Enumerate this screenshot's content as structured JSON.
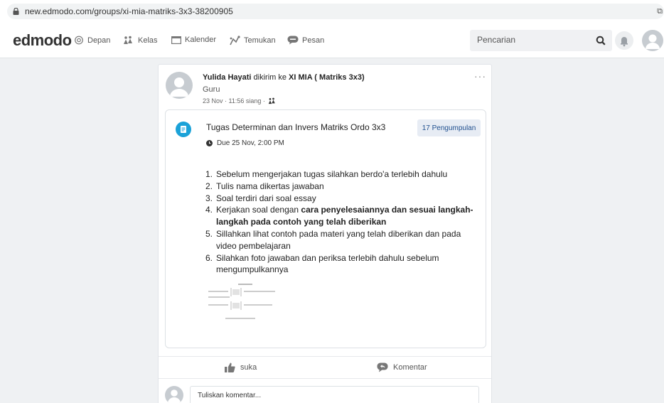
{
  "browser": {
    "url": "new.edmodo.com/groups/xi-mia-matriks-3x3-38200905",
    "ext_glyph": "⧉"
  },
  "nav": {
    "logo": "edmodo",
    "items": [
      {
        "label": "Depan",
        "icon": "home-icon"
      },
      {
        "label": "Kelas",
        "icon": "class-icon"
      },
      {
        "label": "Kalender",
        "icon": "calendar-icon"
      },
      {
        "label": "Temukan",
        "icon": "discover-icon"
      },
      {
        "label": "Pesan",
        "icon": "message-icon"
      }
    ],
    "search_placeholder": "Pencarian"
  },
  "post": {
    "author": "Yulida Hayati",
    "sent_to_text": " dikirim ke ",
    "group": "XI MIA ( Matriks 3x3)",
    "role": "Guru",
    "timestamp": "23 Nov · 11:56 siang ·",
    "more": "···",
    "assignment": {
      "title": "Tugas Determinan dan Invers Matriks Ordo 3x3",
      "due": "Due 25 Nov, 2:00 PM",
      "submissions": "17 Pengumpulan",
      "instructions": [
        {
          "num": "1.",
          "text": "Sebelum mengerjakan tugas silahkan berdo'a terlebih dahulu"
        },
        {
          "num": "2.",
          "text": "Tulis nama dikertas jawaban"
        },
        {
          "num": "3.",
          "text": "Soal terdiri dari soal essay"
        },
        {
          "num": "4.",
          "pre": "Kerjakan soal dengan ",
          "bold": "cara penyelesaiannya dan sesuai langkah-langkah pada contoh yang telah diberikan"
        },
        {
          "num": "5.",
          "text": "Sillahkan lihat contoh pada materi yang telah diberikan dan pada video pembelajaran"
        },
        {
          "num": "6.",
          "text": "Silahkan foto jawaban dan periksa terlebih dahulu sebelum mengumpulkannya"
        }
      ]
    },
    "like_label": "suka",
    "comment_label": "Komentar",
    "comment_placeholder": "Tuliskan komentar..."
  },
  "colors": {
    "accent": "#1ba2d8",
    "submit_text": "#1f4f8e",
    "submit_bg": "#e7ecf4"
  }
}
